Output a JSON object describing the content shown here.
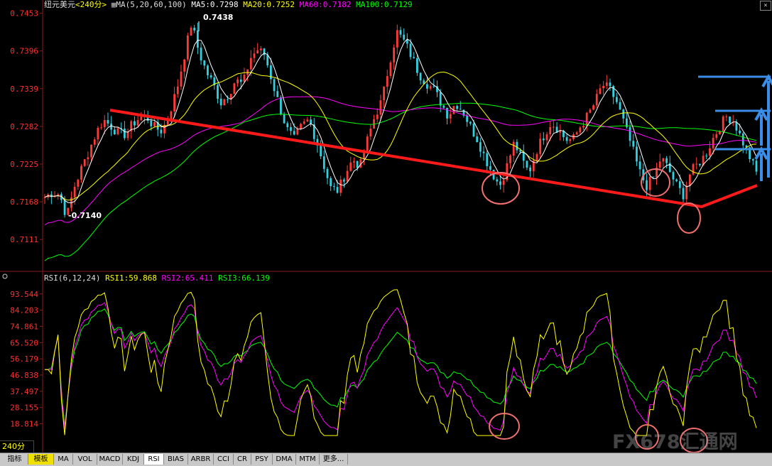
{
  "main_header": {
    "symbol": "纽元美元",
    "period_bracket": "<240分>",
    "ma_params": "MA(5,20,60,100)",
    "ma5": "MA5:0.7298",
    "ma20": "MA20:0.7252",
    "ma60": "MA60:0.7182",
    "ma100": "MA100:0.7129"
  },
  "rsi_header": {
    "params": "RSI(6,12,24)",
    "rsi1": "RSI1:59.868",
    "rsi2": "RSI2:65.411",
    "rsi3": "RSI3:66.139"
  },
  "period_label": "240分",
  "close_glyph": "×",
  "watermark": "FX678汇通网",
  "bottom_tabs": [
    "指标",
    "模板",
    "MA",
    "VOL",
    "MACD",
    "KDJ",
    "RSI",
    "BIAS",
    "ARBR",
    "CCI",
    "CR",
    "PSY",
    "DMA",
    "MTM",
    "更多..."
  ],
  "active_tab": "RSI",
  "colors": {
    "background": "#000000",
    "up_candle": "#ff3a3a",
    "down_candle": "#33d0e0",
    "ma5": "#ffffff",
    "ma20": "#ffff00",
    "ma60": "#ff00ff",
    "ma100": "#00ff00",
    "trendline": "#ff1a1a",
    "circle": "#f07070",
    "arrow": "#3a8ee8",
    "price_axis_label": "#ff3030"
  },
  "chart_data": [
    {
      "type": "candlestick",
      "title": "纽元美元<240分>",
      "y_ticks": [
        0.7453,
        0.7396,
        0.7339,
        0.7282,
        0.7225,
        0.7168,
        0.7111
      ],
      "ylim": [
        0.7065,
        0.7458
      ],
      "annotations": [
        {
          "label": "0.7438",
          "value": 0.7438
        },
        {
          "label": "0.7140",
          "value": 0.714
        }
      ],
      "indicators": {
        "MA5": 0.7298,
        "MA20": 0.7252,
        "MA60": 0.7182,
        "MA100": 0.7129
      },
      "close_path": [
        0.7175,
        0.7182,
        0.718,
        0.7145,
        0.719,
        0.7218,
        0.7245,
        0.7272,
        0.7292,
        0.7283,
        0.7272,
        0.727,
        0.7286,
        0.7296,
        0.7295,
        0.728,
        0.7275,
        0.7302,
        0.7338,
        0.7388,
        0.7438,
        0.7395,
        0.7365,
        0.7345,
        0.7318,
        0.733,
        0.7352,
        0.7345,
        0.7385,
        0.7398,
        0.739,
        0.735,
        0.7312,
        0.7278,
        0.7262,
        0.7282,
        0.7292,
        0.7262,
        0.7225,
        0.7188,
        0.7185,
        0.7212,
        0.7232,
        0.7222,
        0.7262,
        0.7298,
        0.7322,
        0.738,
        0.7425,
        0.741,
        0.7388,
        0.7362,
        0.7348,
        0.7338,
        0.7318,
        0.7298,
        0.7318,
        0.7305,
        0.7282,
        0.7262,
        0.7235,
        0.7212,
        0.7192,
        0.7222,
        0.7258,
        0.7232,
        0.7212,
        0.7245,
        0.7268,
        0.7288,
        0.7278,
        0.7262,
        0.7262,
        0.7282,
        0.7298,
        0.7318,
        0.7345,
        0.7338,
        0.7318,
        0.7285,
        0.7252,
        0.7215,
        0.7192,
        0.7205,
        0.7235,
        0.7218,
        0.7195,
        0.7178,
        0.7212,
        0.7225,
        0.7238,
        0.7262,
        0.7282,
        0.7298,
        0.7288,
        0.7262,
        0.7238,
        0.7212
      ]
    },
    {
      "type": "line",
      "title": "RSI(6,12,24)",
      "y_ticks": [
        93.544,
        84.203,
        74.861,
        65.52,
        56.179,
        46.838,
        37.497,
        28.155,
        18.814
      ],
      "ylim": [
        10,
        100
      ],
      "series": [
        {
          "name": "RSI1",
          "last": 59.868,
          "color": "#ffff00"
        },
        {
          "name": "RSI2",
          "last": 65.411,
          "color": "#ff00ff"
        },
        {
          "name": "RSI3",
          "last": 66.139,
          "color": "#00ff00"
        }
      ]
    }
  ]
}
